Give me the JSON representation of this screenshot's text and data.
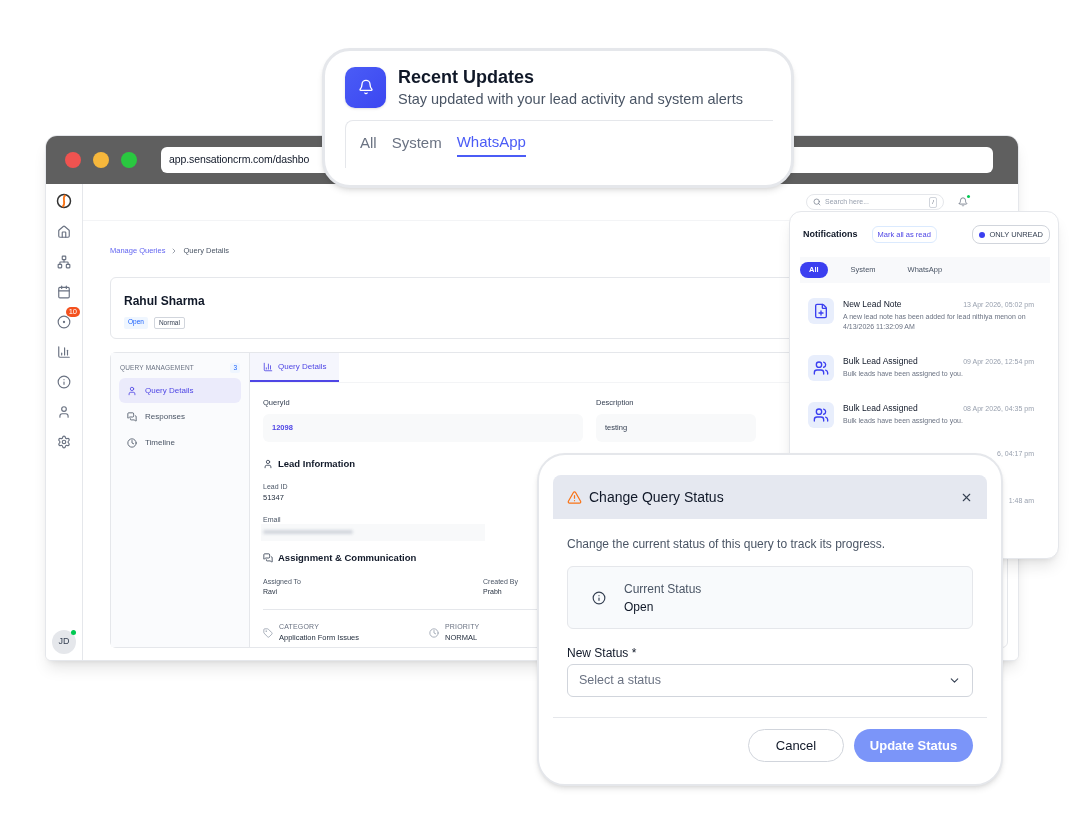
{
  "browser": {
    "url": "app.sensationcrm.com/dashbo"
  },
  "sidebar": {
    "badge": "10",
    "avatar": "JD",
    "online": true
  },
  "header": {
    "search_placeholder": "Search here...",
    "shortcut": "/",
    "unread": true
  },
  "breadcrumb": [
    "Manage Queries",
    "Query Details"
  ],
  "lead": {
    "name": "Rahul Sharma",
    "tags": [
      {
        "label": "Open",
        "kind": "status"
      },
      {
        "label": "Normal",
        "kind": "priority"
      }
    ]
  },
  "query_nav": {
    "title": "QUERY MANAGEMENT",
    "count": "3",
    "items": [
      {
        "label": "Query Details",
        "selected": true
      },
      {
        "label": "Responses",
        "selected": false
      },
      {
        "label": "Timeline",
        "selected": false
      }
    ]
  },
  "content_tabs": [
    {
      "label": "Query Details",
      "selected": true
    }
  ],
  "fields": [
    {
      "label": "QueryId",
      "value": "12098",
      "kind": "link"
    },
    {
      "label": "Description",
      "value": "testing",
      "kind": "plain"
    }
  ],
  "lead_information": {
    "title": "Lead Information",
    "lead_id_label": "Lead ID",
    "lead_id": "51347",
    "email_label": "Email"
  },
  "assignment": {
    "title": "Assignment & Communication",
    "assigned_to_label": "Assigned To",
    "assigned_to": "Ravi",
    "created_by_label": "Created By",
    "created_by": "Prabh"
  },
  "meta": [
    {
      "label": "CATEGORY",
      "value": "Application Form Issues",
      "kind": "tag"
    },
    {
      "label": "PRIORITY",
      "value": "NORMAL",
      "kind": "clock"
    }
  ],
  "recent_updates": {
    "title": "Recent Updates",
    "subtitle": "Stay updated with your lead activity and system alerts",
    "tabs": [
      {
        "label": "All",
        "selected": false
      },
      {
        "label": "System",
        "selected": false
      },
      {
        "label": "WhatsApp",
        "selected": true
      }
    ]
  },
  "notifications": {
    "title": "Notifications",
    "mark_all": "Mark all as read",
    "only_unread": {
      "label": "ONLY UNREAD",
      "on": true
    },
    "tabs": [
      {
        "label": "All",
        "selected": true
      },
      {
        "label": "System",
        "selected": false
      },
      {
        "label": "WhatsApp",
        "selected": false
      }
    ],
    "items": [
      {
        "kind": "note",
        "title": "New Lead Note",
        "time": "13 Apr 2026, 05:02 pm",
        "body": "A new lead note has been added for lead nithiya menon on 4/13/2026 11:32:09 AM"
      },
      {
        "kind": "group",
        "title": "Bulk Lead Assigned",
        "time": "09 Apr 2026, 12:54 pm",
        "body": "Bulk leads have been assigned to you."
      },
      {
        "kind": "group",
        "title": "Bulk Lead Assigned",
        "time": "08 Apr 2026, 04:35 pm",
        "body": "Bulk leads have been assigned to you."
      },
      {
        "kind": "hidden",
        "time": "6, 04:17 pm"
      },
      {
        "kind": "hidden",
        "time": "1:48 am"
      }
    ]
  },
  "dialog": {
    "title": "Change Query Status",
    "text": "Change the current status of this query to track its progress.",
    "current_label": "Current Status",
    "current_value": "Open",
    "new_label": "New Status *",
    "placeholder": "Select a status",
    "cancel": "Cancel",
    "submit": "Update Status",
    "submit_disabled": true
  }
}
